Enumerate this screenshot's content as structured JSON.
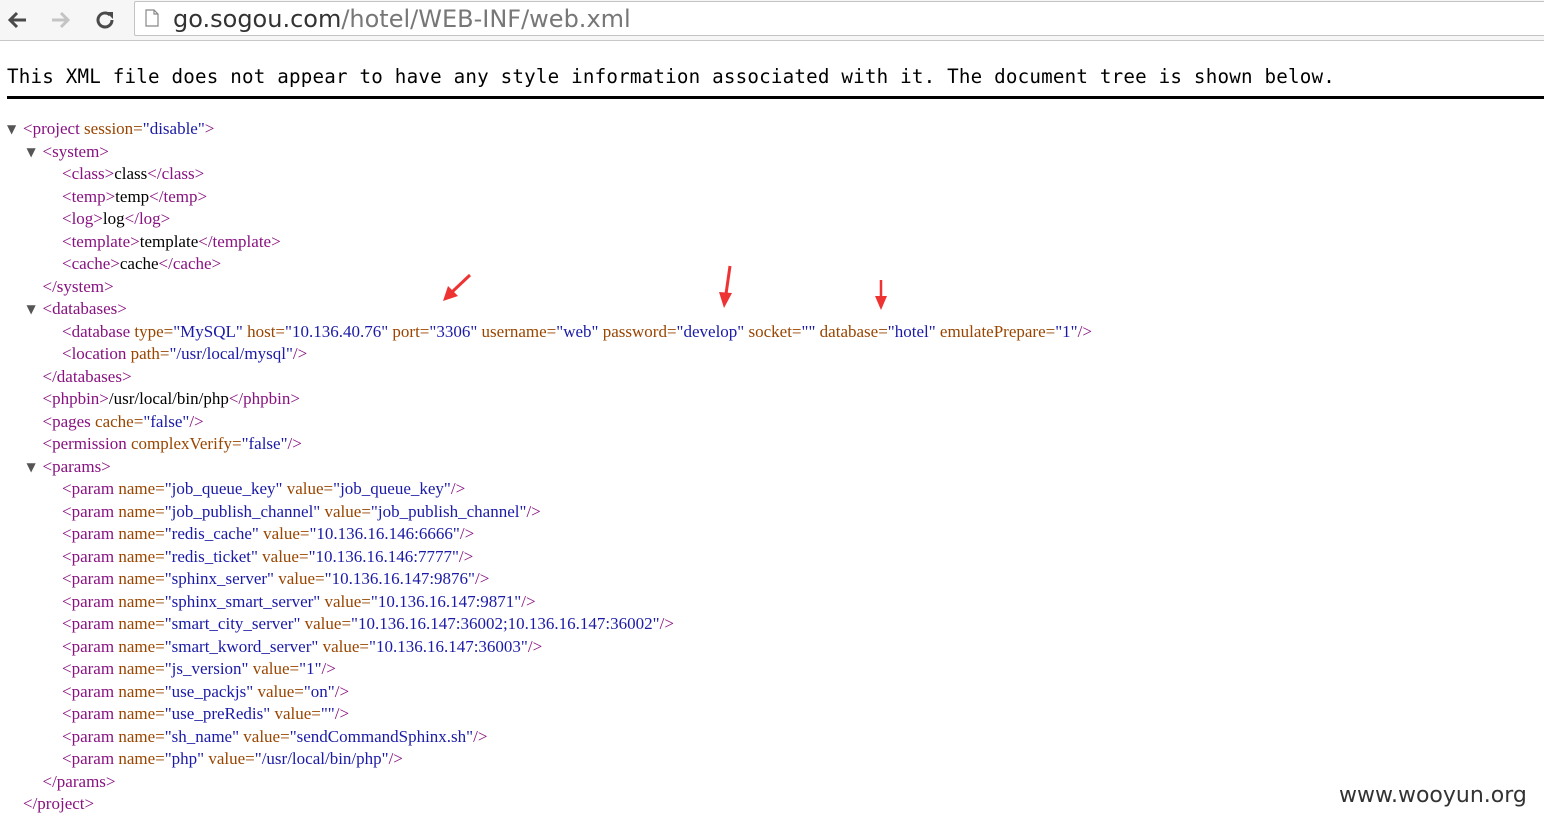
{
  "browser": {
    "back_icon": "back-arrow-icon",
    "forward_icon": "forward-arrow-icon",
    "reload_icon": "reload-icon",
    "url_host": "go.sogou.com",
    "url_path": "/hotel/WEB-INF/web.xml"
  },
  "notice": "This XML file does not appear to have any style information associated with it. The document tree is shown below.",
  "watermark": "www.wooyun.org",
  "colors": {
    "tag": "#881280",
    "attr_name": "#994500",
    "attr_value": "#1a1aa6",
    "arrow": "#ee3333"
  },
  "xml": [
    {
      "toggle": "▼",
      "tokens": [
        [
          "t",
          "<project"
        ],
        [
          "a",
          " session="
        ],
        [
          "v",
          "\"disable\""
        ],
        [
          "t",
          ">"
        ]
      ]
    },
    {
      "toggle": "▼",
      "tokens": [
        [
          "t",
          "<system>"
        ]
      ]
    },
    {
      "tokens": [
        [
          "t",
          "<class>"
        ],
        [
          "x",
          "class"
        ],
        [
          "t",
          "</class>"
        ]
      ]
    },
    {
      "tokens": [
        [
          "t",
          "<temp>"
        ],
        [
          "x",
          "temp"
        ],
        [
          "t",
          "</temp>"
        ]
      ]
    },
    {
      "tokens": [
        [
          "t",
          "<log>"
        ],
        [
          "x",
          "log"
        ],
        [
          "t",
          "</log>"
        ]
      ]
    },
    {
      "tokens": [
        [
          "t",
          "<template>"
        ],
        [
          "x",
          "template"
        ],
        [
          "t",
          "</template>"
        ]
      ]
    },
    {
      "tokens": [
        [
          "t",
          "<cache>"
        ],
        [
          "x",
          "cache"
        ],
        [
          "t",
          "</cache>"
        ]
      ]
    },
    {
      "tokens": [
        [
          "t",
          "</system>"
        ]
      ]
    },
    {
      "toggle": "▼",
      "tokens": [
        [
          "t",
          "<databases>"
        ]
      ]
    },
    {
      "tokens": [
        [
          "t",
          "<database"
        ],
        [
          "a",
          " type="
        ],
        [
          "v",
          "\"MySQL\""
        ],
        [
          "a",
          " host="
        ],
        [
          "v",
          "\"10.136.40.76\""
        ],
        [
          "a",
          " port="
        ],
        [
          "v",
          "\"3306\""
        ],
        [
          "a",
          " username="
        ],
        [
          "v",
          "\"web\""
        ],
        [
          "a",
          " password="
        ],
        [
          "v",
          "\"develop\""
        ],
        [
          "a",
          " socket="
        ],
        [
          "v",
          "\"\""
        ],
        [
          "a",
          " database="
        ],
        [
          "v",
          "\"hotel\""
        ],
        [
          "a",
          " emulatePrepare="
        ],
        [
          "v",
          "\"1\""
        ],
        [
          "t",
          "/>"
        ]
      ]
    },
    {
      "tokens": [
        [
          "t",
          "<location"
        ],
        [
          "a",
          " path="
        ],
        [
          "v",
          "\"/usr/local/mysql\""
        ],
        [
          "t",
          "/>"
        ]
      ]
    },
    {
      "tokens": [
        [
          "t",
          "</databases>"
        ]
      ]
    },
    {
      "tokens": [
        [
          "t",
          "<phpbin>"
        ],
        [
          "x",
          "/usr/local/bin/php"
        ],
        [
          "t",
          "</phpbin>"
        ]
      ]
    },
    {
      "tokens": [
        [
          "t",
          "<pages"
        ],
        [
          "a",
          " cache="
        ],
        [
          "v",
          "\"false\""
        ],
        [
          "t",
          "/>"
        ]
      ]
    },
    {
      "tokens": [
        [
          "t",
          "<permission"
        ],
        [
          "a",
          " complexVerify="
        ],
        [
          "v",
          "\"false\""
        ],
        [
          "t",
          "/>"
        ]
      ]
    },
    {
      "toggle": "▼",
      "tokens": [
        [
          "t",
          "<params>"
        ]
      ]
    },
    {
      "tokens": [
        [
          "t",
          "<param"
        ],
        [
          "a",
          " name="
        ],
        [
          "v",
          "\"job_queue_key\""
        ],
        [
          "a",
          " value="
        ],
        [
          "v",
          "\"job_queue_key\""
        ],
        [
          "t",
          "/>"
        ]
      ]
    },
    {
      "tokens": [
        [
          "t",
          "<param"
        ],
        [
          "a",
          " name="
        ],
        [
          "v",
          "\"job_publish_channel\""
        ],
        [
          "a",
          " value="
        ],
        [
          "v",
          "\"job_publish_channel\""
        ],
        [
          "t",
          "/>"
        ]
      ]
    },
    {
      "tokens": [
        [
          "t",
          "<param"
        ],
        [
          "a",
          " name="
        ],
        [
          "v",
          "\"redis_cache\""
        ],
        [
          "a",
          " value="
        ],
        [
          "v",
          "\"10.136.16.146:6666\""
        ],
        [
          "t",
          "/>"
        ]
      ]
    },
    {
      "tokens": [
        [
          "t",
          "<param"
        ],
        [
          "a",
          " name="
        ],
        [
          "v",
          "\"redis_ticket\""
        ],
        [
          "a",
          " value="
        ],
        [
          "v",
          "\"10.136.16.146:7777\""
        ],
        [
          "t",
          "/>"
        ]
      ]
    },
    {
      "tokens": [
        [
          "t",
          "<param"
        ],
        [
          "a",
          " name="
        ],
        [
          "v",
          "\"sphinx_server\""
        ],
        [
          "a",
          " value="
        ],
        [
          "v",
          "\"10.136.16.147:9876\""
        ],
        [
          "t",
          "/>"
        ]
      ]
    },
    {
      "tokens": [
        [
          "t",
          "<param"
        ],
        [
          "a",
          " name="
        ],
        [
          "v",
          "\"sphinx_smart_server\""
        ],
        [
          "a",
          " value="
        ],
        [
          "v",
          "\"10.136.16.147:9871\""
        ],
        [
          "t",
          "/>"
        ]
      ]
    },
    {
      "tokens": [
        [
          "t",
          "<param"
        ],
        [
          "a",
          " name="
        ],
        [
          "v",
          "\"smart_city_server\""
        ],
        [
          "a",
          " value="
        ],
        [
          "v",
          "\"10.136.16.147:36002;10.136.16.147:36002\""
        ],
        [
          "t",
          "/>"
        ]
      ]
    },
    {
      "tokens": [
        [
          "t",
          "<param"
        ],
        [
          "a",
          " name="
        ],
        [
          "v",
          "\"smart_kword_server\""
        ],
        [
          "a",
          " value="
        ],
        [
          "v",
          "\"10.136.16.147:36003\""
        ],
        [
          "t",
          "/>"
        ]
      ]
    },
    {
      "tokens": [
        [
          "t",
          "<param"
        ],
        [
          "a",
          " name="
        ],
        [
          "v",
          "\"js_version\""
        ],
        [
          "a",
          " value="
        ],
        [
          "v",
          "\"1\""
        ],
        [
          "t",
          "/>"
        ]
      ]
    },
    {
      "tokens": [
        [
          "t",
          "<param"
        ],
        [
          "a",
          " name="
        ],
        [
          "v",
          "\"use_packjs\""
        ],
        [
          "a",
          " value="
        ],
        [
          "v",
          "\"on\""
        ],
        [
          "t",
          "/>"
        ]
      ]
    },
    {
      "tokens": [
        [
          "t",
          "<param"
        ],
        [
          "a",
          " name="
        ],
        [
          "v",
          "\"use_preRedis\""
        ],
        [
          "a",
          " value="
        ],
        [
          "v",
          "\"\""
        ],
        [
          "t",
          "/>"
        ]
      ]
    },
    {
      "tokens": [
        [
          "t",
          "<param"
        ],
        [
          "a",
          " name="
        ],
        [
          "v",
          "\"sh_name\""
        ],
        [
          "a",
          " value="
        ],
        [
          "v",
          "\"sendCommandSphinx.sh\""
        ],
        [
          "t",
          "/>"
        ]
      ]
    },
    {
      "tokens": [
        [
          "t",
          "<param"
        ],
        [
          "a",
          " name="
        ],
        [
          "v",
          "\"php\""
        ],
        [
          "a",
          " value="
        ],
        [
          "v",
          "\"/usr/local/bin/php\""
        ],
        [
          "t",
          "/>"
        ]
      ]
    },
    {
      "tokens": [
        [
          "t",
          "</params>"
        ]
      ]
    },
    {
      "tokens": [
        [
          "t",
          "</project>"
        ]
      ]
    }
  ]
}
